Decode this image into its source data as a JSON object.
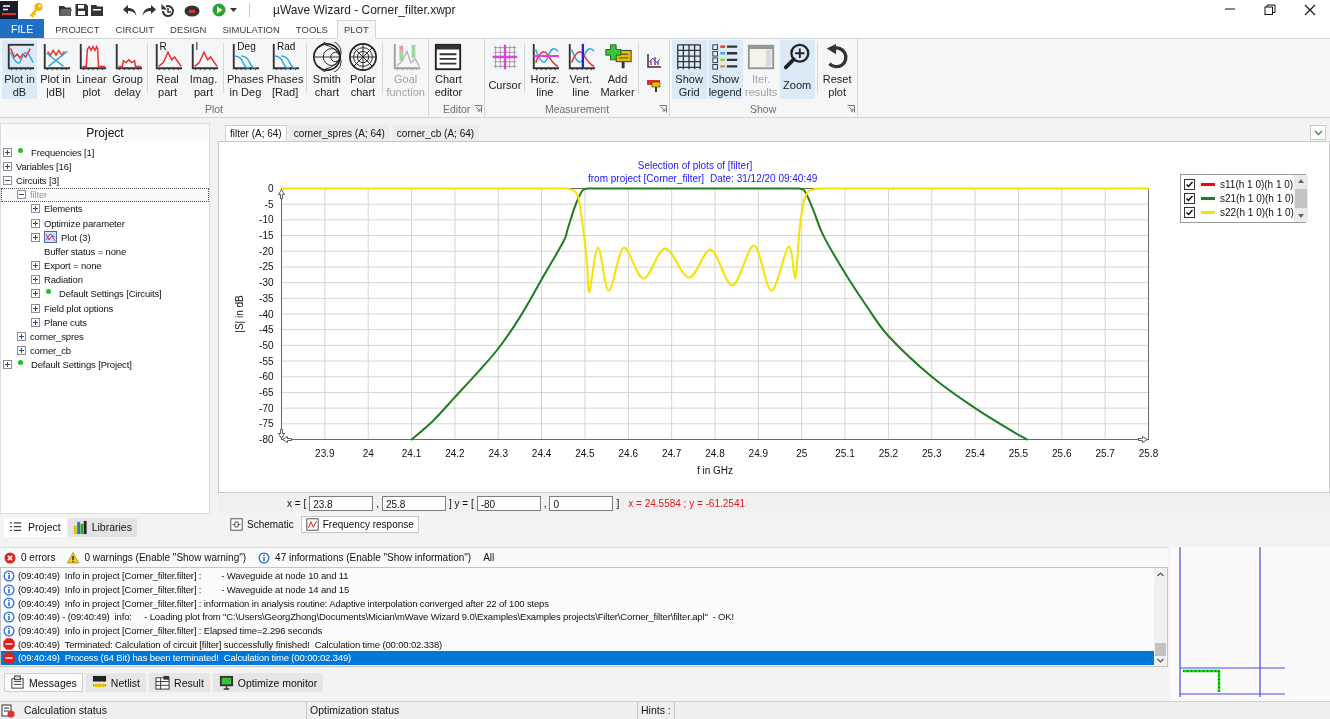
{
  "window": {
    "title": "µWave Wizard - Corner_filter.xwpr"
  },
  "menu_tabs": [
    {
      "label": "FILE",
      "kind": "file",
      "selected": false
    },
    {
      "label": "PROJECT",
      "kind": "tab",
      "selected": false
    },
    {
      "label": "CIRCUIT",
      "kind": "tab",
      "selected": false
    },
    {
      "label": "DESIGN",
      "kind": "tab",
      "selected": false
    },
    {
      "label": "SIMULATION",
      "kind": "tab",
      "selected": false
    },
    {
      "label": "TOOLS",
      "kind": "tab",
      "selected": false
    },
    {
      "label": "PLOT",
      "kind": "tab",
      "selected": true
    }
  ],
  "ribbon": [
    {
      "label": "Plot",
      "launcher": false,
      "sections": [
        {
          "buttons": [
            {
              "kind": "dbplot",
              "lines": [
                "Plot in",
                "dB"
              ],
              "on": true,
              "disabled": false
            },
            {
              "kind": "absdb",
              "lines": [
                "Plot in",
                "|dB|"
              ],
              "on": false,
              "disabled": false
            },
            {
              "kind": "linear",
              "lines": [
                "Linear",
                "plot"
              ],
              "on": false,
              "disabled": false
            },
            {
              "kind": "groupdelay",
              "lines": [
                "Group",
                "delay"
              ],
              "on": false,
              "disabled": false
            }
          ]
        },
        {
          "buttons": [
            {
              "kind": "real",
              "icon_text": "R",
              "lines": [
                "Real",
                "part"
              ],
              "on": false,
              "disabled": false
            },
            {
              "kind": "imag",
              "icon_text": "I",
              "lines": [
                "Imag.",
                "part"
              ],
              "on": false,
              "disabled": false
            }
          ]
        },
        {
          "buttons": [
            {
              "kind": "phasedeg",
              "icon_text": "Deg",
              "lines": [
                "Phases",
                "in Deg"
              ],
              "on": false,
              "disabled": false
            },
            {
              "kind": "phaserad",
              "icon_text": "Rad",
              "lines": [
                "Phases",
                "[Rad]"
              ],
              "on": false,
              "disabled": false
            }
          ]
        },
        {
          "buttons": [
            {
              "kind": "smith",
              "lines": [
                "Smith",
                "chart"
              ],
              "on": false,
              "disabled": false
            },
            {
              "kind": "polar",
              "lines": [
                "Polar",
                "chart"
              ],
              "on": false,
              "disabled": false
            }
          ]
        },
        {
          "buttons": [
            {
              "kind": "goal",
              "lines": [
                "Goal",
                "function"
              ],
              "on": false,
              "disabled": true
            }
          ]
        }
      ]
    },
    {
      "label": "Editor",
      "launcher": true,
      "sections": [
        {
          "buttons": [
            {
              "kind": "editor",
              "lines": [
                "Chart",
                "editor"
              ],
              "on": false,
              "disabled": false
            }
          ]
        }
      ]
    },
    {
      "label": "Measurement",
      "launcher": true,
      "sections": [
        {
          "buttons": [
            {
              "kind": "cursor",
              "lines": [
                "Cursor"
              ],
              "on": false,
              "disabled": false
            }
          ]
        },
        {
          "buttons": [
            {
              "kind": "hline",
              "lines": [
                "Horiz.",
                "line"
              ],
              "on": false,
              "disabled": false
            },
            {
              "kind": "vline",
              "lines": [
                "Vert.",
                "line"
              ],
              "on": false,
              "disabled": false
            },
            {
              "kind": "marker",
              "lines": [
                "Add",
                "Marker"
              ],
              "on": false,
              "disabled": false
            }
          ]
        },
        {
          "buttons": [
            {
              "kind": "minichart",
              "on": false,
              "disabled": false
            },
            {
              "kind": "markerflag",
              "on": false,
              "disabled": false
            }
          ]
        }
      ]
    },
    {
      "label": "Show",
      "launcher": true,
      "sections": [
        {
          "buttons": [
            {
              "kind": "grid",
              "lines": [
                "Show",
                "Grid"
              ],
              "on": true,
              "disabled": false
            },
            {
              "kind": "legend",
              "lines": [
                "Show",
                "legend"
              ],
              "on": true,
              "disabled": false
            },
            {
              "kind": "iter",
              "lines": [
                "Iter.",
                "results"
              ],
              "on": false,
              "disabled": true
            },
            {
              "kind": "zoom",
              "lines": [
                "Zoom"
              ],
              "on": true,
              "disabled": false
            }
          ]
        },
        {
          "buttons": [
            {
              "kind": "reset",
              "lines": [
                "Reset",
                "plot"
              ],
              "on": false,
              "disabled": false
            }
          ]
        }
      ]
    }
  ],
  "project_panel": {
    "title": "Project",
    "tree": [
      {
        "label": "Frequencies [1]",
        "kind": "dot",
        "expanded": false,
        "selected": false
      },
      {
        "label": "Variables [16]",
        "kind": "node",
        "expanded": false,
        "selected": false
      },
      {
        "label": "Circuits [3]",
        "kind": "node",
        "expanded": true,
        "selected": false,
        "children": [
          {
            "label": "filter",
            "kind": "node",
            "expanded": true,
            "selected": true,
            "children": [
              {
                "label": "Elements",
                "kind": "node",
                "expanded": false,
                "selected": false
              },
              {
                "label": "Optimize parameter",
                "kind": "node",
                "expanded": false,
                "selected": false
              },
              {
                "label": "Plot (3)",
                "kind": "plot",
                "expanded": false,
                "selected": false
              },
              {
                "label": "Buffer status = none",
                "kind": "leaf",
                "selected": false
              },
              {
                "label": "Export = none",
                "kind": "node",
                "expanded": false,
                "selected": false
              },
              {
                "label": "Radiation",
                "kind": "node",
                "expanded": false,
                "selected": false
              },
              {
                "label": "Default Settings [Circuits]",
                "kind": "dot",
                "expanded": false,
                "selected": false
              },
              {
                "label": "Field plot options",
                "kind": "node",
                "expanded": false,
                "selected": false
              },
              {
                "label": "Plane cuts",
                "kind": "node",
                "expanded": false,
                "selected": false
              }
            ]
          },
          {
            "label": "corner_spres",
            "kind": "node",
            "expanded": false,
            "selected": false
          },
          {
            "label": "corner_cb",
            "kind": "node",
            "expanded": false,
            "selected": false
          }
        ]
      },
      {
        "label": "Default Settings [Project]",
        "kind": "dot",
        "expanded": false,
        "selected": false
      }
    ],
    "tabs": [
      {
        "label": "Project",
        "kind": "project",
        "selected": true
      },
      {
        "label": "Libraries",
        "kind": "libraries",
        "selected": false
      }
    ]
  },
  "plot_tabs": [
    {
      "label": "filter (A; 64)",
      "selected": true
    },
    {
      "label": "corner_spres (A; 64)",
      "selected": false
    },
    {
      "label": "corner_cb (A; 64)",
      "selected": false
    }
  ],
  "plot": {
    "subtitle": "from project [Corner_filter]",
    "date": "Date: 31/12/20 09:40:49",
    "legend": [
      {
        "checked": true
      },
      {
        "checked": true
      },
      {
        "checked": true
      }
    ],
    "chart_data": {
      "type": "line",
      "title": "Selection of plots of [filter]",
      "xlabel": "f in GHz",
      "ylabel": "|S| in dB",
      "grid": true,
      "legend": "upper right",
      "x": [
        23.8,
        24.0,
        24.1,
        24.15,
        24.2,
        24.25,
        24.3,
        24.35,
        24.4,
        24.45,
        24.46,
        24.475,
        24.485,
        24.495,
        24.505,
        24.51,
        24.53,
        24.555,
        24.59,
        24.635,
        24.685,
        24.74,
        24.79,
        24.84,
        24.89,
        24.93,
        24.97,
        24.985,
        24.995,
        25.005,
        25.015,
        25.03,
        25.05,
        25.1,
        25.15,
        25.2,
        25.3,
        25.4,
        25.5,
        25.52,
        25.6,
        25.8
      ],
      "series": [
        {
          "name": "s11(h 1 0)(h 1 0)",
          "color": "#ff0000",
          "values": [
            null,
            null,
            null,
            null,
            null,
            null,
            null,
            null,
            null,
            null,
            null,
            null,
            null,
            null,
            null,
            null,
            null,
            null,
            null,
            null,
            null,
            null,
            null,
            null,
            null,
            null,
            null,
            null,
            null,
            null,
            null,
            null,
            null,
            null,
            null,
            null,
            null,
            null,
            null,
            null,
            null,
            null
          ]
        },
        {
          "name": "s21(h 1 0)(h 1 0)",
          "color": "#1e7d1e",
          "values": [
            null,
            null,
            -80,
            -74,
            -66.5,
            -59,
            -51,
            -41,
            -29,
            -17,
            -13,
            -6.5,
            -3,
            -0.5,
            0,
            0,
            0,
            0,
            0,
            0,
            0,
            0,
            0,
            0,
            0,
            0,
            0,
            0,
            0,
            -0.5,
            -3,
            -8,
            -15,
            -27,
            -37.5,
            -47,
            -60,
            -70,
            -78.5,
            -80,
            null,
            null
          ]
        },
        {
          "name": "s22(h 1 0)(h 1 0)",
          "color": "#f5e400",
          "values": [
            0,
            0,
            0,
            0,
            0,
            0,
            0,
            0,
            0,
            0,
            0,
            -0.8,
            -3,
            -12,
            -24,
            -33,
            -18.8,
            -32.5,
            -18.8,
            -28.7,
            -19.1,
            -28.4,
            -19.4,
            -30.9,
            -18.2,
            -32.5,
            -18.5,
            -28.7,
            -13,
            -4,
            -1,
            -0.2,
            0,
            0,
            0,
            0,
            0,
            0,
            0,
            0,
            0,
            0
          ]
        }
      ],
      "xlim": [
        23.8,
        25.8
      ],
      "ylim": [
        -80,
        0
      ],
      "xticks": [
        23.9,
        24,
        24.1,
        24.2,
        24.3,
        24.4,
        24.5,
        24.6,
        24.7,
        24.8,
        24.9,
        25,
        25.1,
        25.2,
        25.3,
        25.4,
        25.5,
        25.6,
        25.7,
        25.8
      ],
      "yticks": [
        0,
        -5,
        -10,
        -15,
        -20,
        -25,
        -30,
        -35,
        -40,
        -45,
        -50,
        -55,
        -60,
        -65,
        -70,
        -75,
        -80
      ]
    }
  },
  "range_bar": {
    "parts": [
      {
        "kind": "label",
        "text": "x = ["
      },
      {
        "kind": "input",
        "text": "23.8"
      },
      {
        "kind": "label",
        "text": ","
      },
      {
        "kind": "input",
        "text": "25.8"
      },
      {
        "kind": "label",
        "text": "] y = ["
      },
      {
        "kind": "input",
        "text": "-80"
      },
      {
        "kind": "label",
        "text": ","
      },
      {
        "kind": "input",
        "text": "0"
      },
      {
        "kind": "label",
        "text": "]"
      }
    ],
    "readout": "x = 24.5584 ; y = -61.2541"
  },
  "view_tabs": [
    {
      "label": "Schematic",
      "kind": "schematic",
      "selected": false
    },
    {
      "label": "Frequency response",
      "kind": "freq",
      "selected": true
    }
  ],
  "messages": {
    "filters": [
      {
        "kind": "error",
        "label": "0 errors"
      },
      {
        "kind": "warning",
        "label": "0 warnings (Enable \"Show warning\")"
      },
      {
        "kind": "info",
        "label": "47 informations (Enable \"Show information\")"
      },
      {
        "kind": "all",
        "label": "All"
      }
    ],
    "rows": [
      {
        "kind": "info",
        "text": "(09:40:49)  Info in project [Corner_filter.filter] :        - Waveguide at node 10 and 11",
        "selected": false
      },
      {
        "kind": "info",
        "text": "(09:40:49)  Info in project [Corner_filter.filter] :        - Waveguide at node 14 and 15",
        "selected": false
      },
      {
        "kind": "info",
        "text": "(09:40:49)  Info in project [Corner_filter.filter] : information in analysis routine: Adaptive interpolation converged after 22 of 100 steps",
        "selected": false
      },
      {
        "kind": "info",
        "text": "(09:40:49) - (09:40:49)  info:     - Loading plot from \"C:\\Users\\GeorgZhong\\Documents\\Mician\\mWave Wizard 9.0\\Examples\\Examples projects\\Filter\\Corner_filter\\filter.apl\"  - OK!",
        "selected": false
      },
      {
        "kind": "info",
        "text": "(09:40:49)  Info in project [Corner_filter.filter] : Elapsed time=2.296 seconds",
        "selected": false
      },
      {
        "kind": "stop",
        "text": "(09:40:49)  Terminated: Calculation of circuit [filter] successfully finished!  Calculation time (00:00:02.338)",
        "selected": false
      },
      {
        "kind": "stop",
        "text": "(09:40:49)  Process (64 Bit) has been terminated!  Calculation time (00:00:02.349)",
        "selected": true
      }
    ],
    "tabs": [
      {
        "label": "Messages",
        "kind": "messages",
        "selected": true
      },
      {
        "label": "Netlist",
        "kind": "netlist",
        "selected": false
      },
      {
        "label": "Result",
        "kind": "result",
        "selected": false
      },
      {
        "label": "Optimize monitor",
        "kind": "optimize",
        "selected": false
      }
    ]
  },
  "status_bar": [
    "Calculation status",
    "Optimization status",
    "Hints :"
  ]
}
